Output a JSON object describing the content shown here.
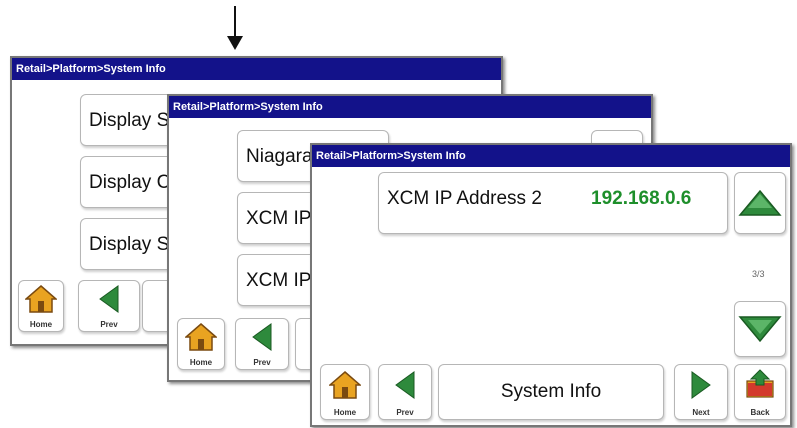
{
  "screen1": {
    "title": "Retail>Platform>System Info",
    "items": [
      "Display S",
      "Display C",
      "Display S"
    ],
    "nav": {
      "home": "Home",
      "prev": "Prev"
    }
  },
  "screen2": {
    "title": "Retail>Platform>System Info",
    "items": [
      "Niagara",
      "XCM IP",
      "XCM IP"
    ],
    "nav": {
      "home": "Home",
      "prev": "Prev"
    }
  },
  "screen3": {
    "title": "Retail>Platform>System Info",
    "item": {
      "label": "XCM IP Address 2",
      "value": "192.168.0.6"
    },
    "page_indicator": "3/3",
    "center_label": "System Info",
    "nav": {
      "home": "Home",
      "prev": "Prev",
      "next": "Next",
      "back": "Back"
    }
  },
  "icons": [
    "arrow-down-icon",
    "home-icon",
    "prev-arrow-icon",
    "next-arrow-icon",
    "back-folder-icon",
    "scroll-up-icon",
    "scroll-down-icon"
  ],
  "colors": {
    "titlebar": "#13128a",
    "value_green": "#1e8f2b",
    "arrow_green": "#2e8a3c"
  }
}
